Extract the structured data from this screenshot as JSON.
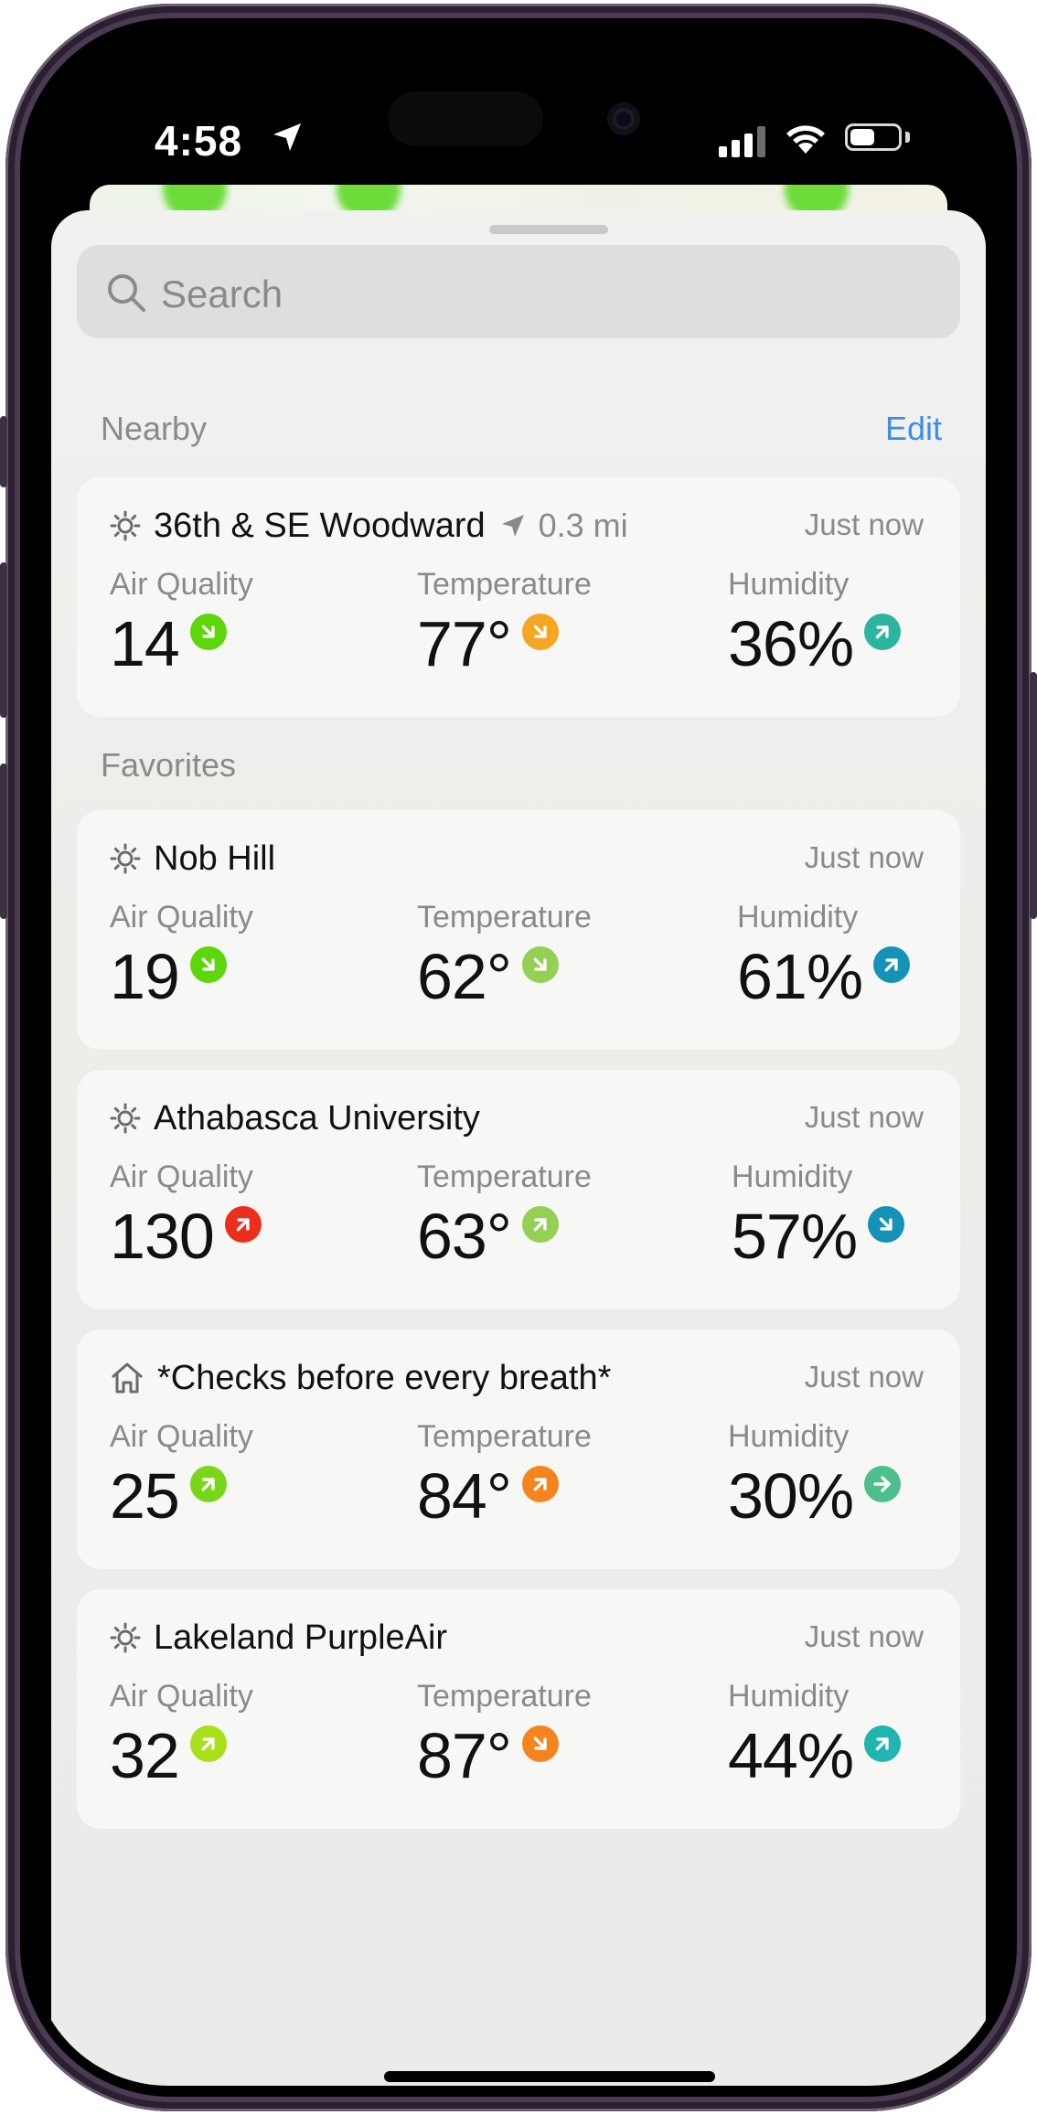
{
  "status_bar": {
    "time": "4:58"
  },
  "search": {
    "placeholder": "Search"
  },
  "nearby": {
    "title": "Nearby",
    "edit_label": "Edit"
  },
  "favorites": {
    "title": "Favorites"
  },
  "colors": {
    "accent": "#3b8ee8",
    "trend_green": "#5ed60c",
    "trend_lightgreen": "#94d053",
    "trend_yellowgreen": "#a8e01a",
    "trend_red": "#ee2e1c",
    "trend_yellow": "#f5a623",
    "trend_orange": "#f5841f",
    "trend_teal": "#2bb5a0",
    "trend_blue": "#1592b8"
  },
  "cards": [
    {
      "icon": "sun-icon",
      "name": "36th & SE Woodward",
      "distance": "0.3 mi",
      "time": "Just now",
      "metrics": [
        {
          "label": "Air Quality",
          "value": "14",
          "trend": "down-right",
          "color": "#5ed60c"
        },
        {
          "label": "Temperature",
          "value": "77°",
          "trend": "down-right",
          "color": "#f5a623"
        },
        {
          "label": "Humidity",
          "value": "36%",
          "trend": "up-right",
          "color": "#2bb5a0"
        }
      ]
    },
    {
      "icon": "sun-icon",
      "name": "Nob Hill",
      "time": "Just now",
      "metrics": [
        {
          "label": "Air Quality",
          "value": "19",
          "trend": "down-right",
          "color": "#5ed60c"
        },
        {
          "label": "Temperature",
          "value": "62°",
          "trend": "down-right",
          "color": "#94d053"
        },
        {
          "label": "Humidity",
          "value": "61%",
          "trend": "up-right",
          "color": "#1592b8"
        }
      ]
    },
    {
      "icon": "sun-icon",
      "name": "Athabasca University",
      "time": "Just now",
      "metrics": [
        {
          "label": "Air Quality",
          "value": "130",
          "trend": "up-right",
          "color": "#ee2e1c"
        },
        {
          "label": "Temperature",
          "value": "63°",
          "trend": "up-right",
          "color": "#94d053"
        },
        {
          "label": "Humidity",
          "value": "57%",
          "trend": "down-right",
          "color": "#1592b8"
        }
      ]
    },
    {
      "icon": "home-icon",
      "name": "*Checks before every breath*",
      "time": "Just now",
      "metrics": [
        {
          "label": "Air Quality",
          "value": "25",
          "trend": "up-right",
          "color": "#7ad61a"
        },
        {
          "label": "Temperature",
          "value": "84°",
          "trend": "up-right",
          "color": "#f5841f"
        },
        {
          "label": "Humidity",
          "value": "30%",
          "trend": "right",
          "color": "#4cbf8a"
        }
      ]
    },
    {
      "icon": "sun-icon",
      "name": "Lakeland PurpleAir",
      "time": "Just now",
      "metrics": [
        {
          "label": "Air Quality",
          "value": "32",
          "trend": "up-right",
          "color": "#a8e01a"
        },
        {
          "label": "Temperature",
          "value": "87°",
          "trend": "down-right",
          "color": "#f5841f"
        },
        {
          "label": "Humidity",
          "value": "44%",
          "trend": "up-right",
          "color": "#1fb5b0"
        }
      ]
    }
  ]
}
